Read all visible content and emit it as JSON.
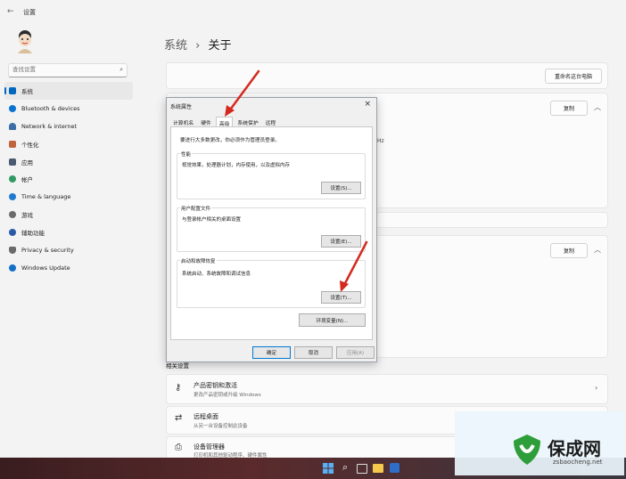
{
  "app": {
    "title": "设置"
  },
  "search": {
    "placeholder": "查找设置"
  },
  "sidebar": {
    "items": [
      {
        "label": "系统",
        "color": "#0067c0"
      },
      {
        "label": "Bluetooth & devices",
        "color": "#0a73d1"
      },
      {
        "label": "Network & internet",
        "color": "#3a6ea5"
      },
      {
        "label": "个性化",
        "color": "#c0623b"
      },
      {
        "label": "应用",
        "color": "#4a5a70"
      },
      {
        "label": "帐户",
        "color": "#2f9a63"
      },
      {
        "label": "Time & language",
        "color": "#1f7bd0"
      },
      {
        "label": "游戏",
        "color": "#6b6b6b"
      },
      {
        "label": "辅助功能",
        "color": "#2a5aa8"
      },
      {
        "label": "Privacy & security",
        "color": "#6a6a6a"
      },
      {
        "label": "Windows Update",
        "color": "#1570c8"
      }
    ]
  },
  "breadcrumb": {
    "parent": "系统",
    "separator": "›",
    "current": "关于"
  },
  "main": {
    "rename_button": "重命名这台电脑",
    "copy_button_1": "复制",
    "copy_button_2": "复制",
    "partial_hz": "Hz",
    "related_title": "相关设置",
    "related": [
      {
        "title": "产品密钥和激活",
        "subtitle": "更改产品密钥或升级 Windows"
      },
      {
        "title": "远程桌面",
        "subtitle": "从另一台设备控制此设备"
      },
      {
        "title": "设备管理器",
        "subtitle": "打印机和其他驱动程序、硬件属性"
      }
    ]
  },
  "dialog": {
    "title": "系统属性",
    "tabs": [
      "计算机名",
      "硬件",
      "高级",
      "系统保护",
      "远程"
    ],
    "admin_note": "要进行大多数更改，你必须作为管理员登录。",
    "performance": {
      "label": "性能",
      "desc": "视觉效果，处理器计划，内存使用，以及虚拟内存",
      "button": "设置(S)..."
    },
    "profile": {
      "label": "用户配置文件",
      "desc": "与登录帐户相关的桌面设置",
      "button": "设置(E)..."
    },
    "startup": {
      "label": "启动和故障恢复",
      "desc": "系统启动、系统故障和调试信息",
      "button": "设置(T)..."
    },
    "env_button": "环境变量(N)...",
    "ok": "确定",
    "cancel": "取消",
    "apply": "应用(A)"
  },
  "watermark": {
    "name": "保成网",
    "url": "zsbaocheng.net"
  },
  "accent": "#0067c0",
  "annotation_color": "#d42a1e"
}
